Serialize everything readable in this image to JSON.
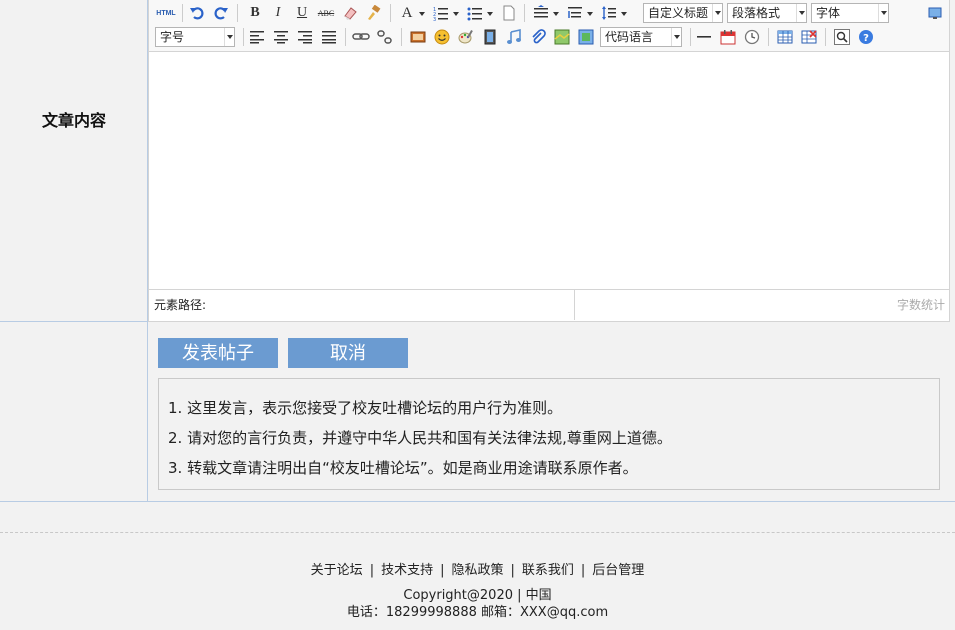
{
  "form": {
    "content_label": "文章内容"
  },
  "editor": {
    "toolbar_row1": {
      "html_label": "HTML",
      "bold": "B",
      "italic": "I",
      "underline": "U",
      "strike": "ABC",
      "font_color": "A",
      "custom_heading": "自定义标题",
      "paragraph_format": "段落格式",
      "font_family": "字体"
    },
    "toolbar_row2": {
      "font_size": "字号",
      "code_language": "代码语言"
    },
    "status_path_label": "元素路径:",
    "word_count_label": "字数统计"
  },
  "actions": {
    "submit_label": "发表帖子",
    "cancel_label": "取消"
  },
  "notice": {
    "items": [
      "1. 这里发言，表示您接受了校友吐槽论坛的用户行为准则。",
      "2. 请对您的言行负责，并遵守中华人民共和国有关法律法规,尊重网上道德。",
      "3. 转载文章请注明出自“校友吐槽论坛”。如是商业用途请联系原作者。"
    ]
  },
  "footer": {
    "links": [
      "关于论坛",
      "技术支持",
      "隐私政策",
      "联系我们",
      "后台管理"
    ],
    "separator": "|",
    "copyright": "Copyright@2020 | 中国",
    "contact": "电话：18299998888 邮箱：XXX@qq.com"
  },
  "colors": {
    "accent_button": "#6b9bd1",
    "border_blue": "#b8cce4",
    "background": "#f2f2f2"
  }
}
